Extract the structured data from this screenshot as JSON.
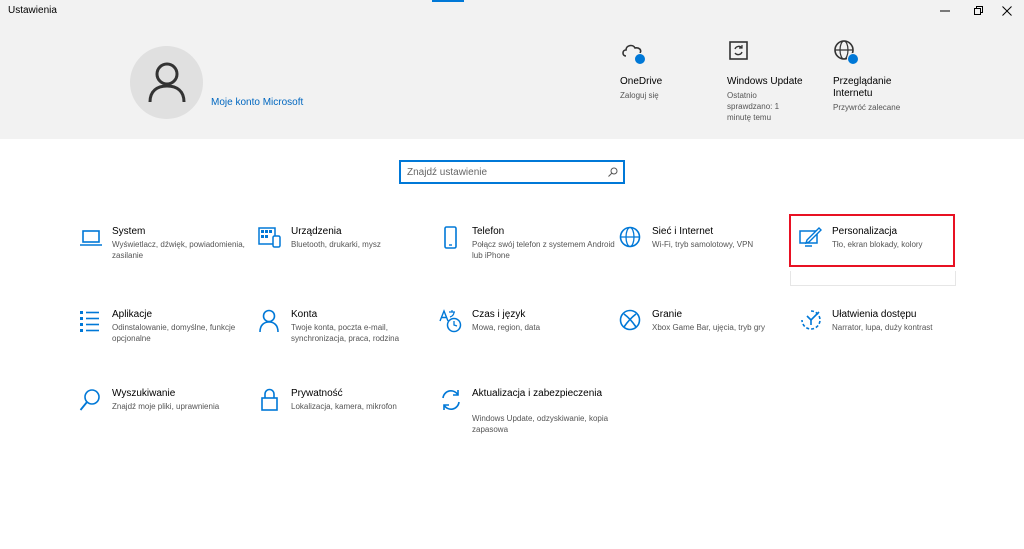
{
  "window": {
    "title": "Ustawienia"
  },
  "account": {
    "link_label": "Moje konto Microsoft"
  },
  "status": [
    {
      "title": "OneDrive",
      "subtitle": "Zaloguj się",
      "icon": "cloud-icon"
    },
    {
      "title": "Windows Update",
      "subtitle": "Ostatnio sprawdzano: 1 minutę temu",
      "icon": "sync-icon"
    },
    {
      "title": "Przeglądanie Internetu",
      "subtitle": "Przywróć zalecane",
      "icon": "globe-icon"
    }
  ],
  "search": {
    "placeholder": "Znajdź ustawienie"
  },
  "tiles": [
    {
      "title": "System",
      "desc": "Wyświetlacz, dźwięk, powiadomienia, zasilanie",
      "icon": "laptop-icon"
    },
    {
      "title": "Urządzenia",
      "desc": "Bluetooth, drukarki, mysz",
      "icon": "devices-icon"
    },
    {
      "title": "Telefon",
      "desc": "Połącz swój telefon z systemem Android lub iPhone",
      "icon": "phone-icon"
    },
    {
      "title": "Sieć i Internet",
      "desc": "Wi-Fi, tryb samolotowy, VPN",
      "icon": "globe-icon"
    },
    {
      "title": "Personalizacja",
      "desc": "Tło, ekran blokady, kolory",
      "icon": "personalization-icon"
    },
    {
      "title": "Aplikacje",
      "desc": "Odinstalowanie, domyślne, funkcje opcjonalne",
      "icon": "apps-list-icon"
    },
    {
      "title": "Konta",
      "desc": "Twoje konta, poczta e-mail, synchronizacja, praca, rodzina",
      "icon": "person-icon"
    },
    {
      "title": "Czas i język",
      "desc": "Mowa, region, data",
      "icon": "time-language-icon"
    },
    {
      "title": "Granie",
      "desc": "Xbox Game Bar, ujęcia, tryb gry",
      "icon": "xbox-icon"
    },
    {
      "title": "Ułatwienia dostępu",
      "desc": "Narrator, lupa, duży kontrast",
      "icon": "ease-of-access-icon"
    },
    {
      "title": "Wyszukiwanie",
      "desc": "Znajdź moje pliki, uprawnienia",
      "icon": "search-icon"
    },
    {
      "title": "Prywatność",
      "desc": "Lokalizacja, kamera, mikrofon",
      "icon": "lock-icon"
    },
    {
      "title": "Aktualizacja i zabezpieczenia",
      "desc": "Windows Update, odzyskiwanie, kopia zapasowa",
      "icon": "update-icon"
    }
  ],
  "colors": {
    "accent": "#0078d7",
    "highlight": "#e81123",
    "header_bg": "#f2f2f2"
  }
}
